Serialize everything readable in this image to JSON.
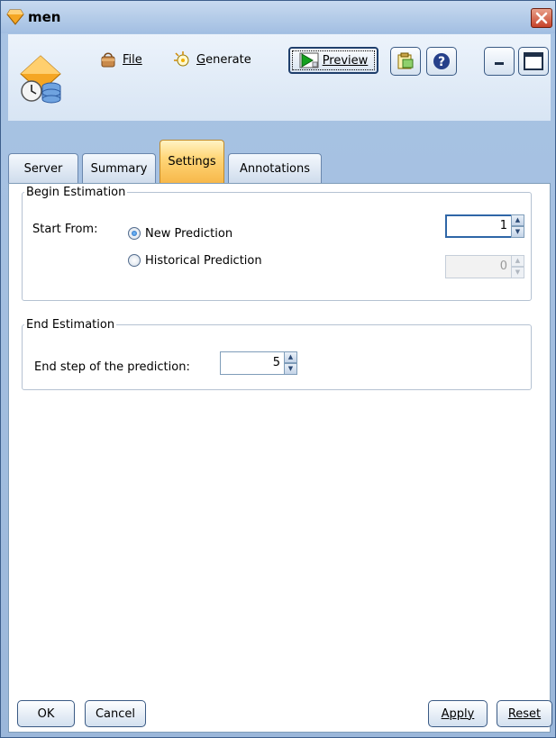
{
  "window": {
    "title": "men"
  },
  "toolbar": {
    "file_label": "File",
    "generate_label": "Generate",
    "preview_label": "Preview"
  },
  "tabs": [
    {
      "label": "Server"
    },
    {
      "label": "Summary"
    },
    {
      "label": "Settings",
      "active": true
    },
    {
      "label": "Annotations"
    }
  ],
  "begin_estimation": {
    "legend": "Begin Estimation",
    "start_from_label": "Start From:",
    "options": [
      {
        "label": "New Prediction",
        "selected": true,
        "value": "1"
      },
      {
        "label": "Historical Prediction",
        "selected": false,
        "value": "0"
      }
    ]
  },
  "end_estimation": {
    "legend": "End Estimation",
    "end_step_label": "End step of the prediction:",
    "end_step_value": "5"
  },
  "buttons": {
    "ok": "OK",
    "cancel": "Cancel",
    "apply": "Apply",
    "reset": "Reset"
  },
  "colors": {
    "active_tab": "#f7b84a",
    "window_frame": "#a9c4e4",
    "close_button": "#c6432a"
  }
}
